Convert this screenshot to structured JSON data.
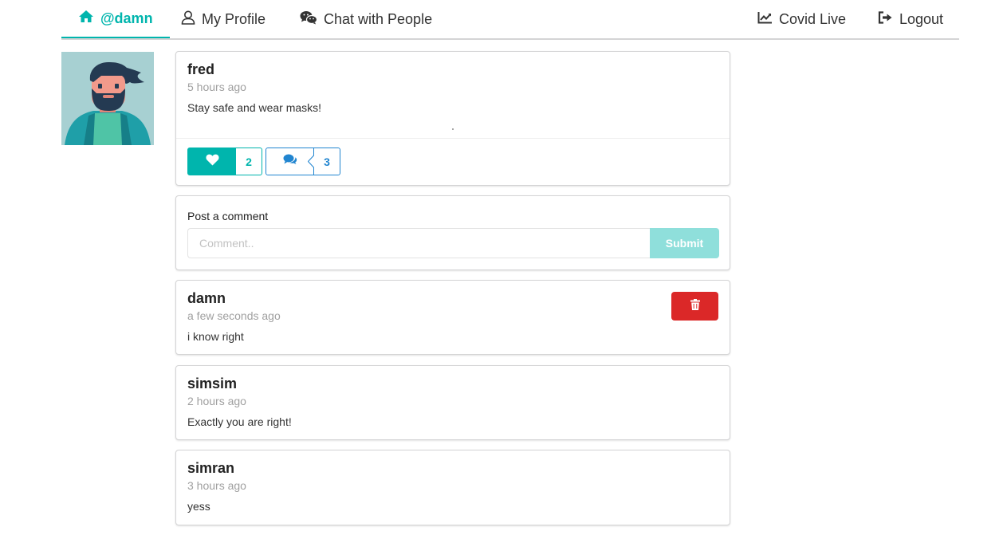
{
  "nav": {
    "home_label": "@damn",
    "profile_label": "My Profile",
    "chat_label": "Chat with People",
    "covid_label": "Covid Live",
    "logout_label": "Logout"
  },
  "post": {
    "author": "fred",
    "time": "5 hours ago",
    "body": "Stay safe and wear masks!",
    "like_count": "2",
    "comment_count": "3"
  },
  "comment_form": {
    "label": "Post a comment",
    "placeholder": "Comment..",
    "value": "",
    "submit_label": "Submit"
  },
  "comments": [
    {
      "author": "damn",
      "time": "a few seconds ago",
      "body": "i know right"
    },
    {
      "author": "simsim",
      "time": "2 hours ago",
      "body": "Exactly you are right!"
    },
    {
      "author": "simran",
      "time": "3 hours ago",
      "body": "yess"
    }
  ],
  "colors": {
    "accent": "#00b5ad",
    "accent_light": "#8fdfdb",
    "blue": "#2185d0",
    "danger": "#db2828"
  },
  "icons": {
    "home": "home-icon",
    "profile": "user-icon",
    "chat": "wechat-icon",
    "covid": "line-chart-icon",
    "logout": "sign-out-icon",
    "like": "heart-icon",
    "comment": "comments-icon",
    "delete": "trash-icon"
  }
}
